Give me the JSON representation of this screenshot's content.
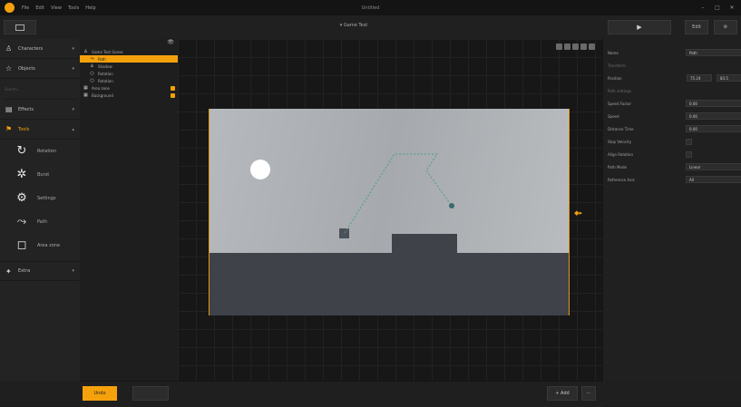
{
  "window": {
    "title": "Untitled",
    "menu": [
      "File",
      "Edit",
      "View",
      "Tools",
      "Help"
    ],
    "controls": [
      "–",
      "□",
      "✕"
    ]
  },
  "toolbar": {
    "scene_label": "▾ Game Test",
    "play_label": "▶",
    "right_btn1": "Edit",
    "right_btn2": "⚙"
  },
  "left_panel": {
    "sections": [
      {
        "icon": "person-icon",
        "glyph": "♙",
        "label": "Characters"
      },
      {
        "icon": "star-icon",
        "glyph": "☆",
        "label": "Objects"
      }
    ],
    "search_placeholder": "Search...",
    "sections2": [
      {
        "icon": "folder-icon",
        "glyph": "▤",
        "label": "Effects"
      },
      {
        "icon": "flag-icon",
        "glyph": "⚑",
        "label": "Tools",
        "active": true
      }
    ],
    "tools": [
      {
        "name": "rotate",
        "glyph": "↻",
        "label": "Rotation"
      },
      {
        "name": "burst",
        "glyph": "✲",
        "label": "Burst"
      },
      {
        "name": "gear",
        "glyph": "⚙",
        "label": "Settings"
      },
      {
        "name": "path",
        "glyph": "⤳",
        "label": "Path"
      },
      {
        "name": "area",
        "glyph": "◻",
        "label": "Area zone"
      }
    ],
    "sections3": [
      {
        "icon": "bolt-icon",
        "glyph": "✦",
        "label": "Extra"
      }
    ]
  },
  "outline": {
    "rows": [
      {
        "label": "Game Test Scene",
        "glyph": "♙",
        "indent": 0
      },
      {
        "label": "Path",
        "glyph": "⤳",
        "indent": 1,
        "selected": true
      },
      {
        "label": "Shadow",
        "glyph": "♙",
        "indent": 1
      },
      {
        "label": "Rotation",
        "glyph": "○",
        "indent": 1
      },
      {
        "label": "Rotation",
        "glyph": "○",
        "indent": 1
      },
      {
        "label": "Area zone",
        "glyph": "▦",
        "indent": 0,
        "locked": true
      },
      {
        "label": "Background",
        "glyph": "▦",
        "indent": 0,
        "locked": true
      }
    ],
    "footer": [
      "⚑",
      "⚙"
    ]
  },
  "properties": {
    "name_label": "Name",
    "name_value": "Path",
    "transform_group": "Transform",
    "rows": [
      {
        "label": "Position",
        "value": "75.24",
        "value2": "83.5"
      }
    ],
    "path_group": "Path settings",
    "settings": [
      {
        "label": "Speed Factor",
        "value": "0.00"
      },
      {
        "label": "Speed",
        "value": "0.00"
      },
      {
        "label": "Distance Time",
        "value": "0.00"
      }
    ],
    "checks": [
      {
        "label": "Stop Velocity"
      },
      {
        "label": "Align Rotation"
      }
    ],
    "dropdowns": [
      {
        "label": "Path Mode",
        "value": "Linear"
      },
      {
        "label": "Reference Axis",
        "value": "All"
      }
    ]
  },
  "bottom": {
    "undo": "Undo",
    "redo": "",
    "add": "+ Add",
    "more": "⋯"
  }
}
